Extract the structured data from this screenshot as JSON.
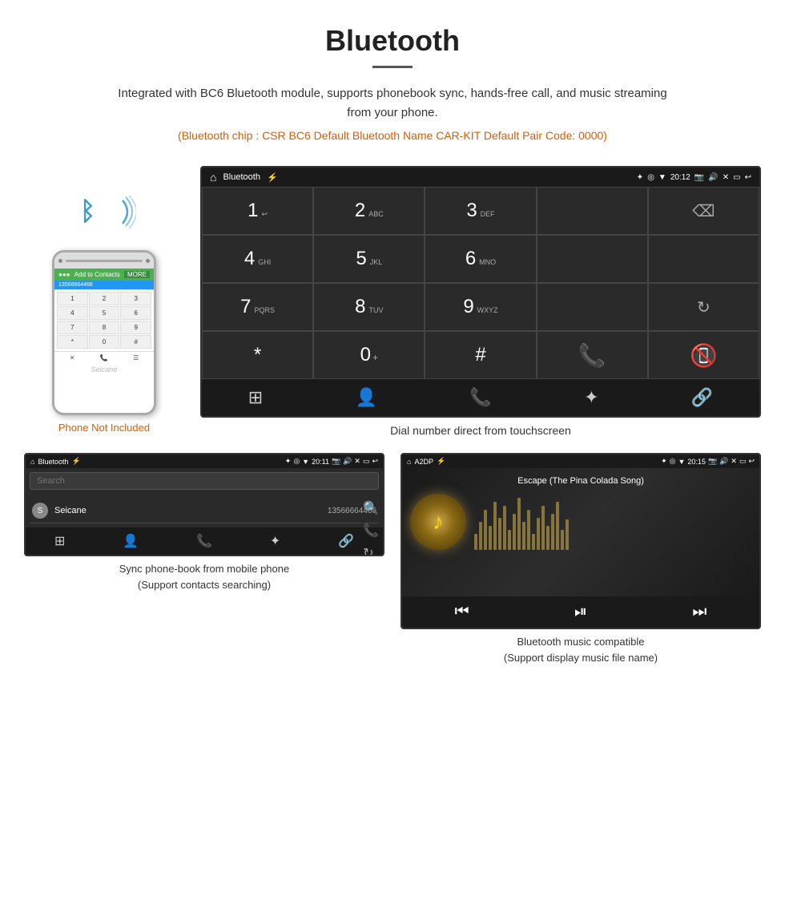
{
  "header": {
    "title": "Bluetooth",
    "description": "Integrated with BC6 Bluetooth module, supports phonebook sync, hands-free call, and music streaming from your phone.",
    "specs": "(Bluetooth chip : CSR BC6    Default Bluetooth Name CAR-KIT    Default Pair Code: 0000)"
  },
  "phone": {
    "not_included": "Phone Not Included",
    "watermark": "Seicane"
  },
  "large_screen": {
    "status": {
      "app_name": "Bluetooth",
      "time": "20:12",
      "home_icon": "⌂",
      "usb_icon": "⚡"
    },
    "dialpad": {
      "keys": [
        {
          "num": "1",
          "sub": "↩"
        },
        {
          "num": "2",
          "sub": "ABC"
        },
        {
          "num": "3",
          "sub": "DEF"
        },
        {
          "num": "4",
          "sub": "GHI"
        },
        {
          "num": "5",
          "sub": "JKL"
        },
        {
          "num": "6",
          "sub": "MNO"
        },
        {
          "num": "7",
          "sub": "PQRS"
        },
        {
          "num": "8",
          "sub": "TUV"
        },
        {
          "num": "9",
          "sub": "WXYZ"
        },
        {
          "num": "*",
          "sub": ""
        },
        {
          "num": "0",
          "sub": "+"
        },
        {
          "num": "#",
          "sub": ""
        }
      ]
    },
    "caption": "Dial number direct from touchscreen"
  },
  "phonebook_screen": {
    "status": {
      "app_name": "Bluetooth",
      "time": "20:11"
    },
    "search_placeholder": "Search",
    "contacts": [
      {
        "initial": "S",
        "name": "Seicane",
        "number": "13566664466"
      }
    ],
    "caption_line1": "Sync phone-book from mobile phone",
    "caption_line2": "(Support contacts searching)"
  },
  "music_screen": {
    "status": {
      "app_name": "A2DP",
      "time": "20:15"
    },
    "song_title": "Escape (The Pina Colada Song)",
    "caption_line1": "Bluetooth music compatible",
    "caption_line2": "(Support display music file name)"
  },
  "icons": {
    "home": "⌂",
    "bluetooth": "✦",
    "call_green": "📞",
    "call_red": "📵",
    "backspace": "⌫",
    "refresh": "↻",
    "dialpad": "⋮⋮⋮",
    "person": "👤",
    "phone": "📱",
    "bt": "❋",
    "link": "🔗",
    "search": "🔍",
    "prev": "⏮",
    "play_pause": "⏯",
    "next": "⏭"
  }
}
